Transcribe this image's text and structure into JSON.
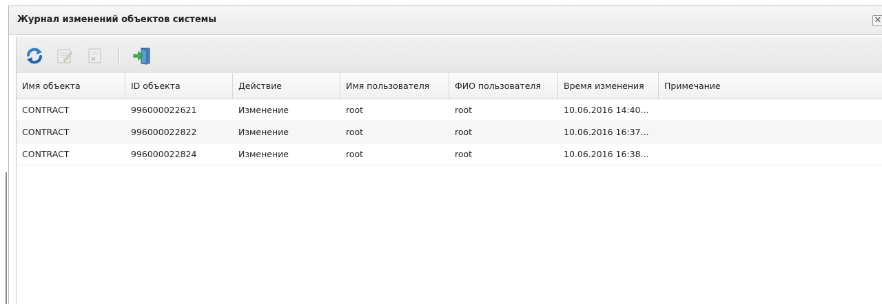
{
  "window": {
    "title": "Журнал изменений объектов системы",
    "close_glyph": "✕"
  },
  "toolbar": {
    "buttons": [
      {
        "icon": "refresh-icon",
        "enabled": true
      },
      {
        "icon": "edit-icon",
        "enabled": false
      },
      {
        "icon": "delete-icon",
        "enabled": false
      },
      {
        "icon": "exit-icon",
        "enabled": true
      }
    ]
  },
  "grid": {
    "columns": [
      "Имя объекта",
      "ID объекта",
      "Действие",
      "Имя пользователя",
      "ФИО пользователя",
      "Время изменения",
      "Примечание"
    ],
    "rows": [
      [
        "CONTRACT",
        "996000022621",
        "Изменение",
        "root",
        "root",
        "10.06.2016 14:40...",
        ""
      ],
      [
        "CONTRACT",
        "996000022822",
        "Изменение",
        "root",
        "root",
        "10.06.2016 16:37...",
        ""
      ],
      [
        "CONTRACT",
        "996000022824",
        "Изменение",
        "root",
        "root",
        "10.06.2016 16:38...",
        ""
      ]
    ]
  }
}
